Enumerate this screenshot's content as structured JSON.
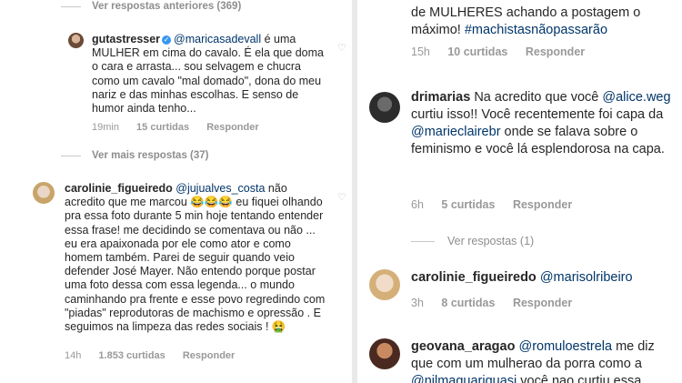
{
  "left": {
    "prev_replies": "Ver respostas anteriores (369)",
    "comment1": {
      "username": "gutastresser",
      "mention": "@maricasadevall",
      "text": " é uma MULHER em cima do cavalo. É ela que doma o cara e arrasta... sou selvagem e chucra como um cavalo \"mal domado\", dona do meu nariz e das minhas escolhas. E senso de humor ainda tenho...",
      "time": "19min",
      "likes": "15 curtidas",
      "reply": "Responder"
    },
    "more_replies": "Ver mais respostas (37)",
    "comment2": {
      "username": "carolinie_figueiredo",
      "mention": "@jujualves_costa",
      "text": " não acredito que me marcou 😂😂😂 eu fiquei olhando pra essa foto durante 5 min  hoje tentando entender essa frase! me decidindo se comentava ou não ... eu era apaixonada por ele como ator e como homem também. Parei de seguir quando veio defender José Mayer. Não entendo porque postar uma foto dessa com essa legenda... o mundo caminhando pra frente e esse povo regredindo com \"piadas\" reprodutoras de machismo e opressão . E seguimos na limpeza das redes sociais ! 🤮",
      "time": "14h",
      "likes": "1.853 curtidas",
      "reply": "Responder"
    }
  },
  "right": {
    "top_text_plain": "de MULHERES achando a postagem o máximo! ",
    "top_hashtag": "#machistasnãopassarão",
    "top_time": "15h",
    "top_likes": "10 curtidas",
    "top_reply": "Responder",
    "comment1": {
      "username": "drimarias",
      "text1": " Na acredito que você ",
      "mention1": "@alice.weg",
      "text2": " curtiu isso!! Você recentemente  foi capa da ",
      "mention2": "@marieclairebr",
      "text3": " onde se falava sobre o feminismo e você lá esplendorosa na capa.",
      "time": "6h",
      "likes": "5 curtidas",
      "reply": "Responder"
    },
    "view_replies": "Ver respostas (1)",
    "comment2": {
      "username": "carolinie_figueiredo",
      "mention": "@marisolribeiro",
      "time": "3h",
      "likes": "8 curtidas",
      "reply": "Responder"
    },
    "comment3": {
      "username": "geovana_aragao",
      "mention1": "@romuloestrela",
      "text1": " me diz que com um mulherao da porra como a ",
      "mention2": "@nilmaguariguasi",
      "text2": " você nao curtiu essa"
    }
  },
  "colors": {
    "mention": "#003569",
    "secondary_text": "#999999",
    "verified": "#3897f0"
  },
  "icons": [
    "heart-icon",
    "verified-badge-icon"
  ]
}
